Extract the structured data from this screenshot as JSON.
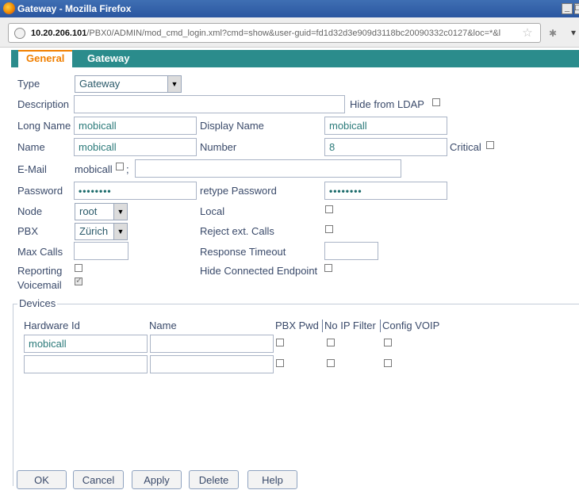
{
  "window": {
    "title": "Gateway - Mozilla Firefox",
    "minimize_glyph": "_",
    "maximize_glyph": "□"
  },
  "urlbar": {
    "host": "10.20.206.101",
    "path": "/PBX0/ADMIN/mod_cmd_login.xml?cmd=show&user-guid=fd1d32d3e909d3118bc20090332c0127&loc=*&l"
  },
  "tabs": [
    {
      "label": "General",
      "active": true
    },
    {
      "label": "Gateway",
      "active": false
    }
  ],
  "form": {
    "type_label": "Type",
    "type_value": "Gateway",
    "description_label": "Description",
    "description_value": "",
    "hide_ldap_label": "Hide from LDAP",
    "long_name_label": "Long Name",
    "long_name_value": "mobicall",
    "display_name_label": "Display Name",
    "display_name_value": "mobicall",
    "name_label": "Name",
    "name_value": "mobicall",
    "number_label": "Number",
    "number_value": "8",
    "critical_label": "Critical",
    "email_label": "E-Mail",
    "email_prefix": "mobicall",
    "email_sep": ";",
    "email_value": "",
    "password_label": "Password",
    "password_value": "••••••••",
    "retype_password_label": "retype Password",
    "retype_password_value": "••••••••",
    "node_label": "Node",
    "node_value": "root",
    "local_label": "Local",
    "pbx_label": "PBX",
    "pbx_value": "Zürich",
    "reject_ext_label": "Reject ext. Calls",
    "max_calls_label": "Max Calls",
    "max_calls_value": "",
    "response_timeout_label": "Response Timeout",
    "response_timeout_value": "",
    "reporting_label": "Reporting",
    "hide_connected_label": "Hide Connected Endpoint",
    "voicemail_label": "Voicemail",
    "voicemail_checked": true
  },
  "devices": {
    "legend": "Devices",
    "col_hardware_id": "Hardware Id",
    "col_name": "Name",
    "col_pbx_pwd": "PBX Pwd",
    "col_no_ip_filter": "No IP Filter",
    "col_config_voip": "Config VOIP",
    "rows": [
      {
        "hardware_id": "mobicall",
        "name": ""
      },
      {
        "hardware_id": "",
        "name": ""
      }
    ]
  },
  "buttons": {
    "ok": "OK",
    "cancel": "Cancel",
    "apply": "Apply",
    "delete": "Delete",
    "help": "Help"
  },
  "colors": {
    "tab_bar": "#2b8c8c",
    "active_tab_text": "#f07f00",
    "field_text": "#2b7a7a"
  }
}
